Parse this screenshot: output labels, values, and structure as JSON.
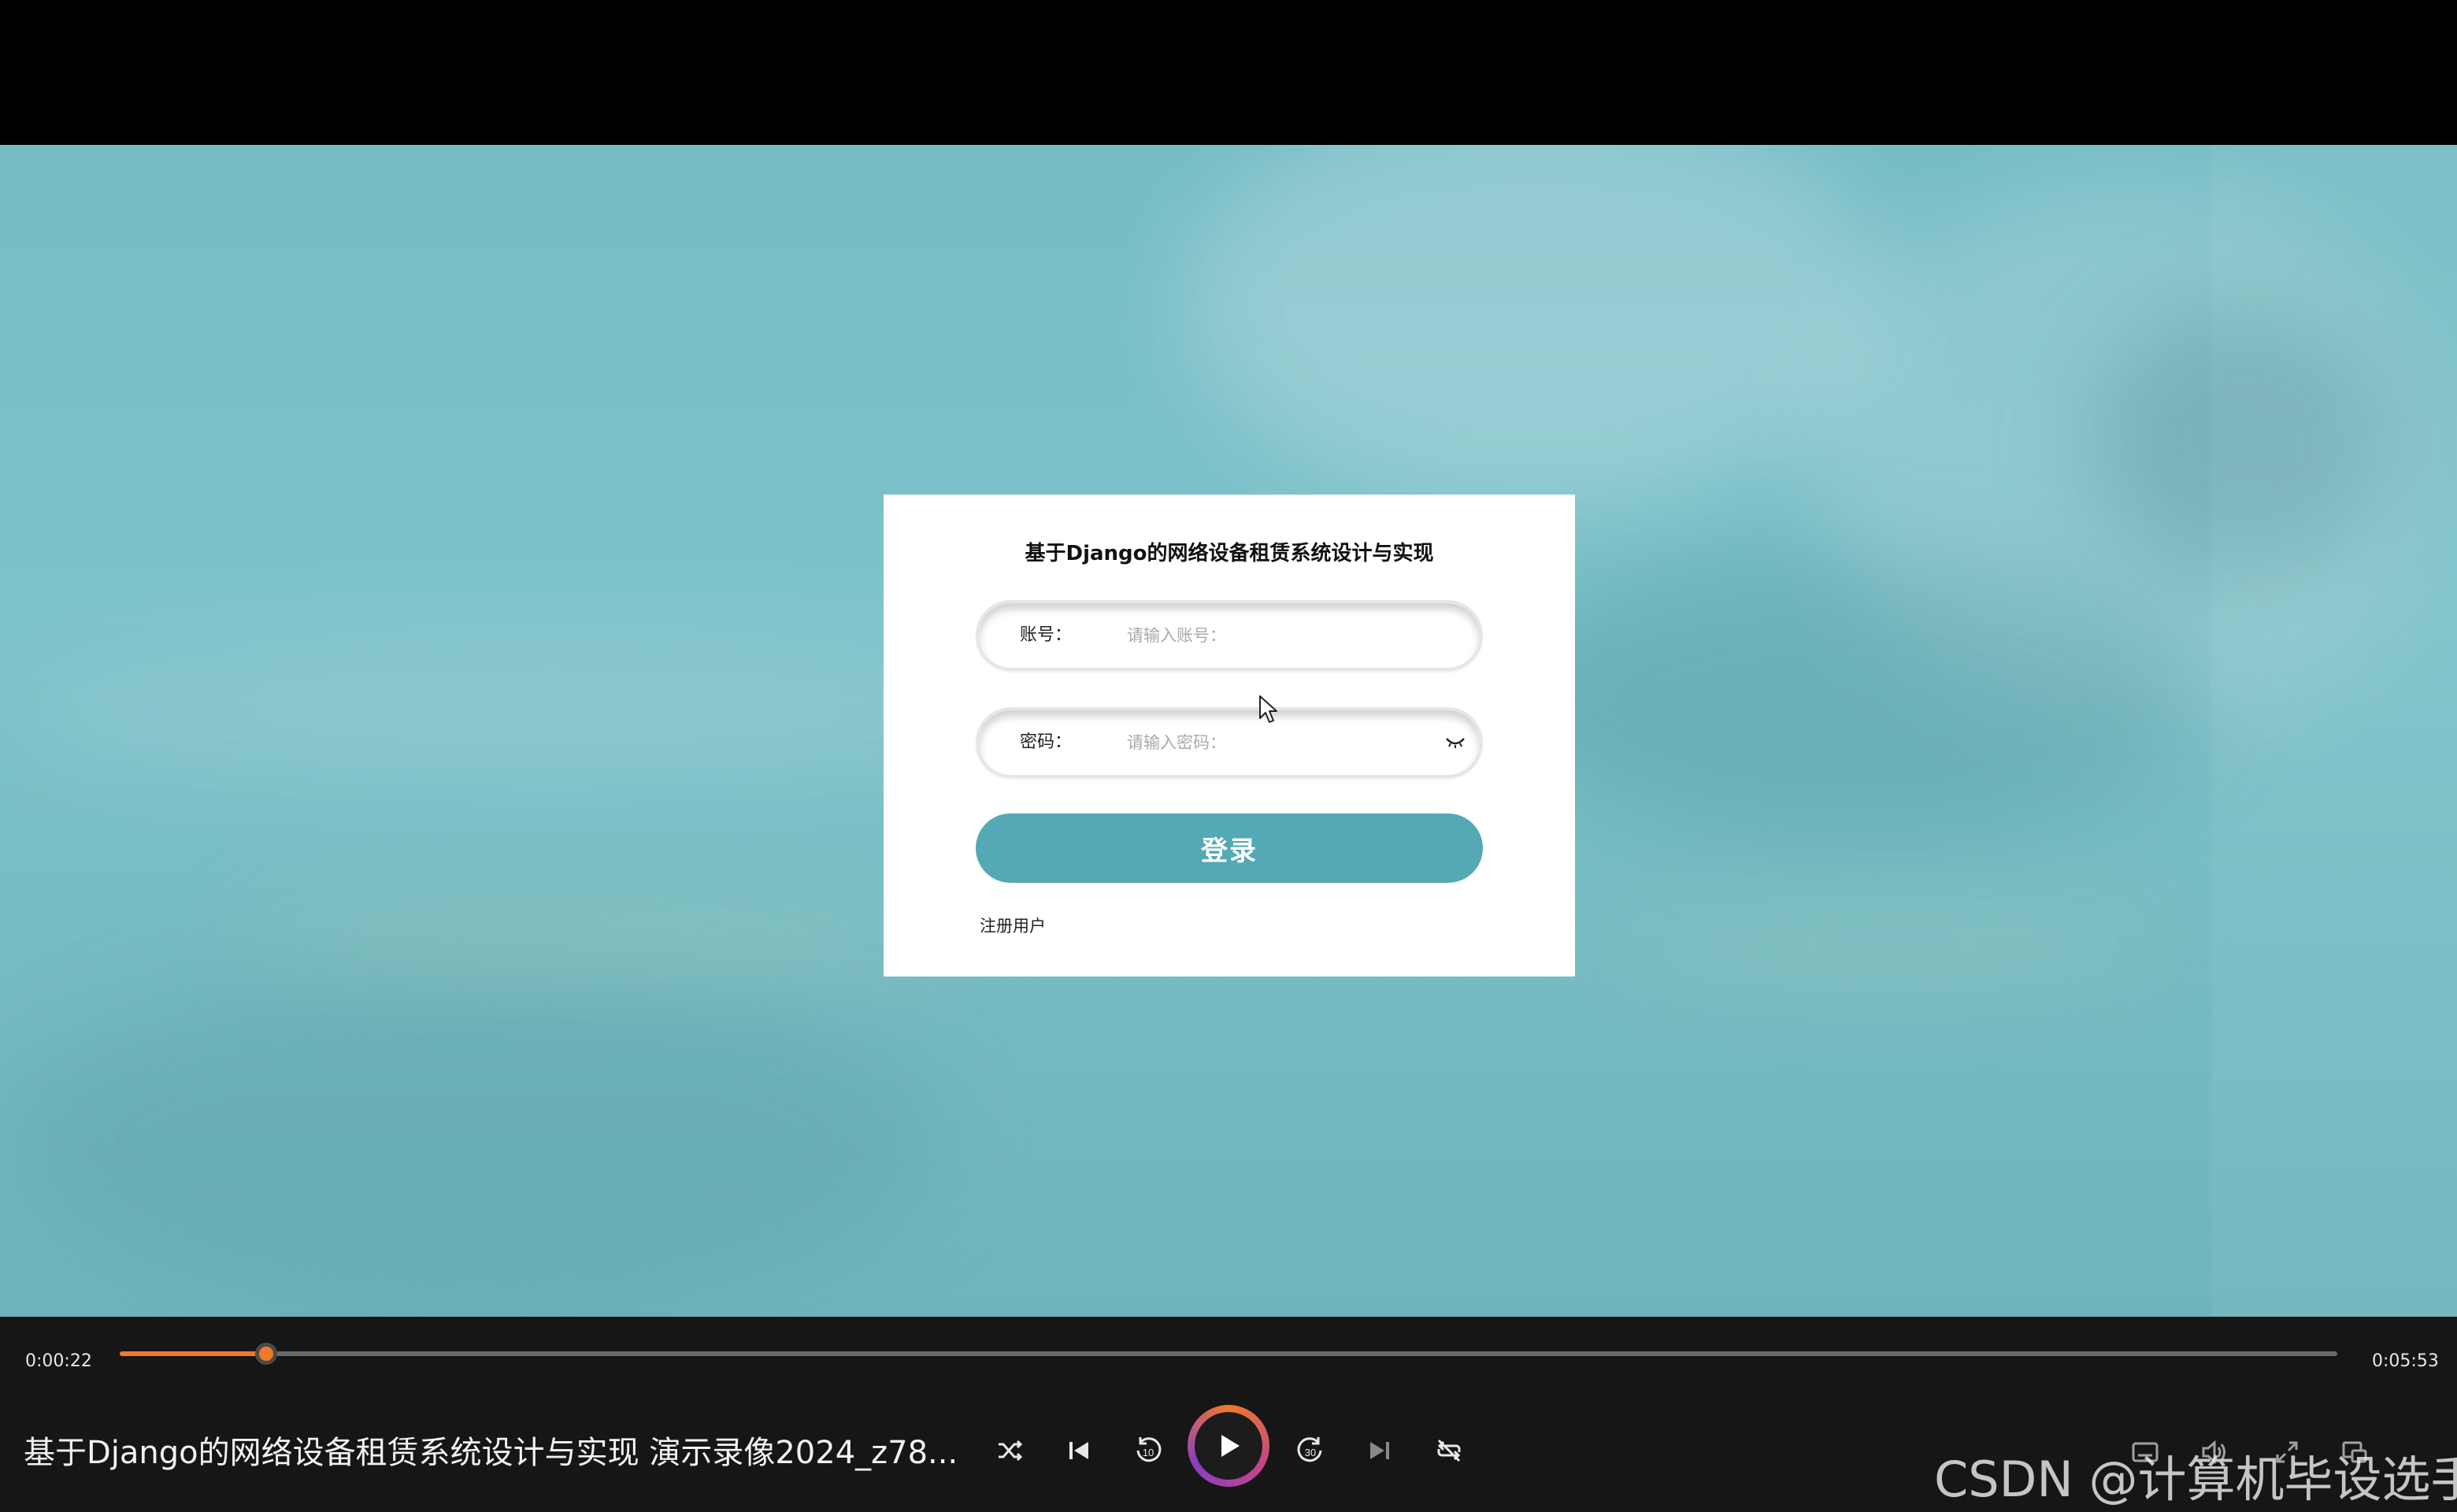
{
  "login": {
    "title": "基于Django的网络设备租赁系统设计与实现",
    "account_label": "账号：",
    "account_placeholder": "请输入账号：",
    "password_label": "密码：",
    "password_placeholder": "请输入密码：",
    "login_button": "登录",
    "register_link": "注册用户"
  },
  "player": {
    "current_time": "0:00:22",
    "total_time": "0:05:53",
    "progress_fraction": 0.066,
    "video_title": "基于Django的网络设备租赁系统设计与实现 演示录像2024_z78...",
    "accent_color": "#f07a28",
    "controls": [
      "shuffle-icon",
      "previous-icon",
      "rewind-10-icon",
      "play-icon",
      "forward-30-icon",
      "next-icon",
      "repeat-off-icon"
    ],
    "right_controls": [
      "subtitles-icon",
      "volume-icon",
      "fullscreen-icon",
      "miniplayer-icon"
    ]
  },
  "watermark": "CSDN @计算机毕设选手",
  "colors": {
    "background_teal": "#76bcc5",
    "login_button": "#54a9b5"
  }
}
